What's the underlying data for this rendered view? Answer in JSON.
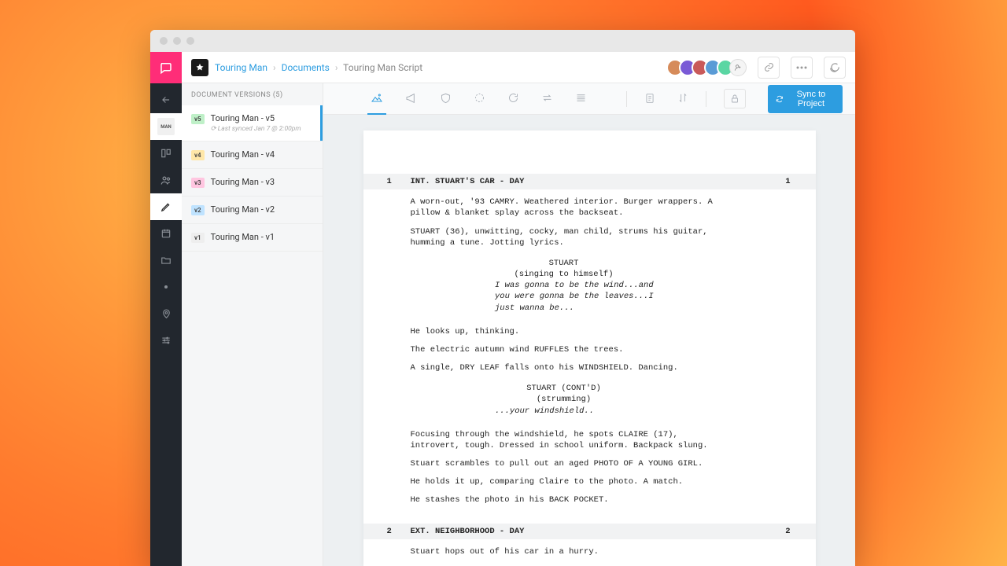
{
  "breadcrumb": {
    "project": "Touring Man",
    "section": "Documents",
    "document": "Touring Man Script"
  },
  "versions": {
    "header": "DOCUMENT VERSIONS (5)",
    "items": [
      {
        "badge": "v5",
        "badge_color": "#bff0c8",
        "title": "Touring Man - v5",
        "sub": "Last synced Jan 7 @ 2:00pm",
        "active": true
      },
      {
        "badge": "v4",
        "badge_color": "#ffe7a8",
        "title": "Touring Man - v4"
      },
      {
        "badge": "v3",
        "badge_color": "#ffc6e0",
        "title": "Touring Man - v3"
      },
      {
        "badge": "v2",
        "badge_color": "#bfe3ff",
        "title": "Touring Man - v2"
      },
      {
        "badge": "v1",
        "badge_color": "#eeeeee",
        "title": "Touring Man - v1"
      }
    ]
  },
  "toolbar": {
    "sync_label": "Sync to Project"
  },
  "avatars": [
    {
      "bg": "#d68b5a"
    },
    {
      "bg": "#7a5ad6"
    },
    {
      "bg": "#c95a5a"
    },
    {
      "bg": "#5a9bd6"
    },
    {
      "bg": "#5ad6a3"
    }
  ],
  "script": {
    "scene1": {
      "num": "1",
      "heading": "INT. STUART'S CAR - DAY",
      "a1": "A worn-out, '93 CAMRY. Weathered interior. Burger wrappers. A pillow & blanket splay across the backseat.",
      "a2": "STUART (36), unwitting, cocky, man child, strums his guitar, humming a tune. Jotting lyrics.",
      "char1": "STUART",
      "paren1": "(singing to himself)",
      "d1": "I was gonna to be the wind...and",
      "d2": "you were gonna be the leaves...I",
      "d3": "just wanna be...",
      "a3": "He looks up, thinking.",
      "a4": "The electric autumn wind RUFFLES the trees.",
      "a5": "A single, DRY LEAF falls onto his WINDSHIELD. Dancing.",
      "char2": "STUART (CONT'D)",
      "paren2": "(strumming)",
      "d4": "...your windshield..",
      "a6": "Focusing through the windshield, he spots CLAIRE (17), introvert, tough. Dressed in school uniform. Backpack slung.",
      "a7": "Stuart scrambles to pull out an aged PHOTO OF A YOUNG GIRL.",
      "a8": "He holds it up, comparing Claire to the photo. A match.",
      "a9": "He stashes the photo in his BACK POCKET."
    },
    "scene2": {
      "num": "2",
      "heading": "EXT. NEIGHBORHOOD - DAY",
      "a1": "Stuart hops out of his car in a hurry."
    }
  }
}
